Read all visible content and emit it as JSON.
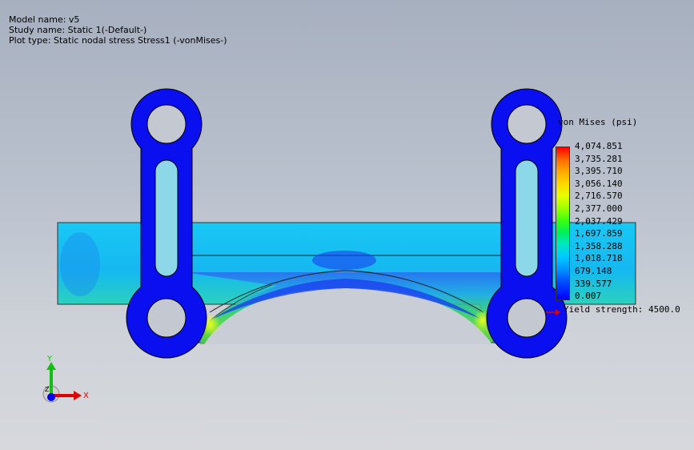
{
  "header": {
    "model_name": "Model name: v5",
    "study_name": "Study name: Static 1(-Default-)",
    "plot_type": "Plot type: Static nodal stress Stress1 (-vonMises-)"
  },
  "legend": {
    "title": "von Mises (psi)",
    "values": [
      "4,074.851",
      "3,735.281",
      "3,395.710",
      "3,056.140",
      "2,716.570",
      "2,377.000",
      "2,037.429",
      "1,697.859",
      "1,358.288",
      "1,018.718",
      "679.148",
      "339.577",
      "0.007"
    ],
    "yield_label": "Yield strength: 4500.0"
  },
  "triad": {
    "x_label": "X",
    "y_label": "Y",
    "z_label": "Z"
  },
  "colors": {
    "link": "#0a0ff0",
    "high_stress": "#ff0000",
    "mid_stress": "#00e6c8",
    "low_stress": "#0000ff"
  }
}
